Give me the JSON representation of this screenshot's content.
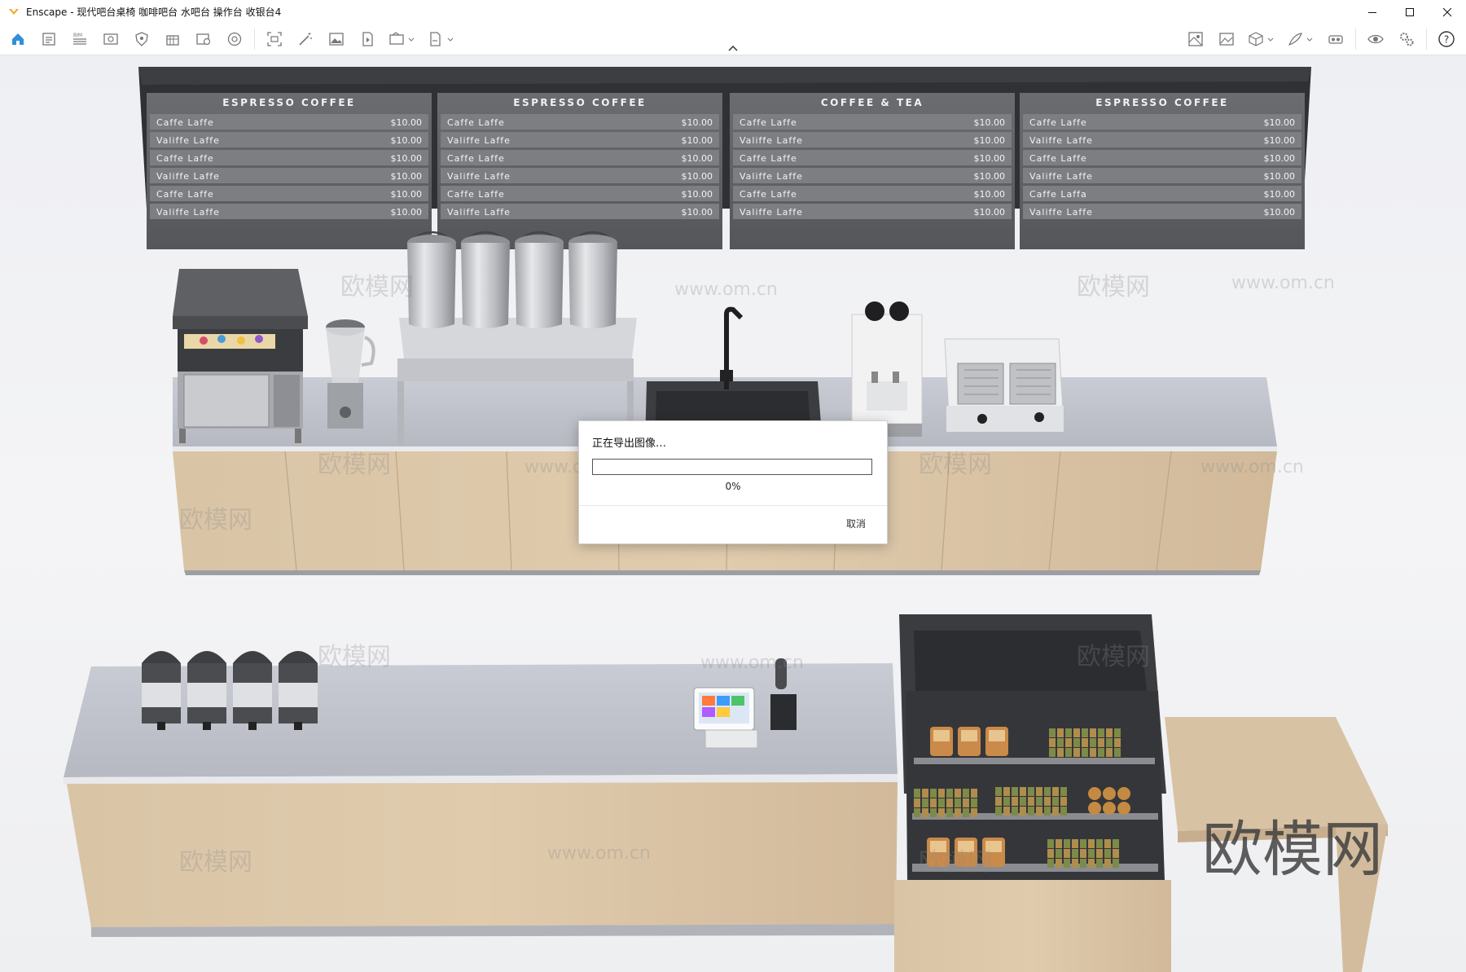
{
  "window": {
    "title": "Enscape - 现代吧台桌椅 咖啡吧台 水吧台 操作台 收银台4",
    "controls": {
      "minimize": "—",
      "maximize": "☐",
      "close": "✕"
    }
  },
  "toolbar": {
    "left_icons": [
      "home-icon",
      "open-file-icon",
      "list-icon",
      "view-icon",
      "shield-icon",
      "building-icon",
      "settings-icon",
      "palette-icon",
      "screenshot-icon",
      "magic-wand-icon",
      "image-icon",
      "video-icon",
      "batch-render-icon",
      "export-icon"
    ],
    "right_icons": [
      "asset-library-icon",
      "image-gallery-icon",
      "cube-icon",
      "feather-icon",
      "vr-headset-icon",
      "eye-icon",
      "settings-gears-icon",
      "help-icon"
    ]
  },
  "menu_boards": [
    {
      "header": "ESPRESSO  COFFEE",
      "items": [
        [
          "Caffe  Laffe",
          "$10.00"
        ],
        [
          "Valiffe  Laffe",
          "$10.00"
        ],
        [
          "Caffe  Laffe",
          "$10.00"
        ],
        [
          "Valiffe  Laffe",
          "$10.00"
        ],
        [
          "Caffe  Laffe",
          "$10.00"
        ],
        [
          "Valiffe  Laffe",
          "$10.00"
        ]
      ]
    },
    {
      "header": "ESPRESSO  COFFEE",
      "items": [
        [
          "Caffe  Laffe",
          "$10.00"
        ],
        [
          "Valiffe  Laffe",
          "$10.00"
        ],
        [
          "Caffe  Laffe",
          "$10.00"
        ],
        [
          "Valiffe  Laffe",
          "$10.00"
        ],
        [
          "Caffe  Laffe",
          "$10.00"
        ],
        [
          "Valiffe  Laffe",
          "$10.00"
        ]
      ]
    },
    {
      "header": "COFFEE  &  TEA",
      "items": [
        [
          "Caffe  Laffe",
          "$10.00"
        ],
        [
          "Valiffe  Laffe",
          "$10.00"
        ],
        [
          "Caffe  Laffe",
          "$10.00"
        ],
        [
          "Valiffe  Laffe",
          "$10.00"
        ],
        [
          "Caffe  Laffe",
          "$10.00"
        ],
        [
          "Valiffe  Laffe",
          "$10.00"
        ]
      ]
    },
    {
      "header": "ESPRESSO  COFFEE",
      "items": [
        [
          "Caffe  Laffe",
          "$10.00"
        ],
        [
          "Valiffe  Laffe",
          "$10.00"
        ],
        [
          "Caffe  Laffe",
          "$10.00"
        ],
        [
          "Valiffe  Laffe",
          "$10.00"
        ],
        [
          "Caffe  Laffa",
          "$10.00"
        ],
        [
          "Valiffe  Laffe",
          "$10.00"
        ]
      ]
    }
  ],
  "watermark": {
    "logo": "欧模网",
    "url": "www.om.cn",
    "corner": "欧模网"
  },
  "dialog": {
    "title": "正在导出图像…",
    "progress_text": "0%",
    "progress_fraction": 0,
    "cancel_label": "取消"
  },
  "colors": {
    "accent": "#2f8fd8",
    "logo_orange": "#f5a623",
    "board": "#4b4d51",
    "wood": "#d6c0a3",
    "counter_top": "#b9bcc4"
  }
}
